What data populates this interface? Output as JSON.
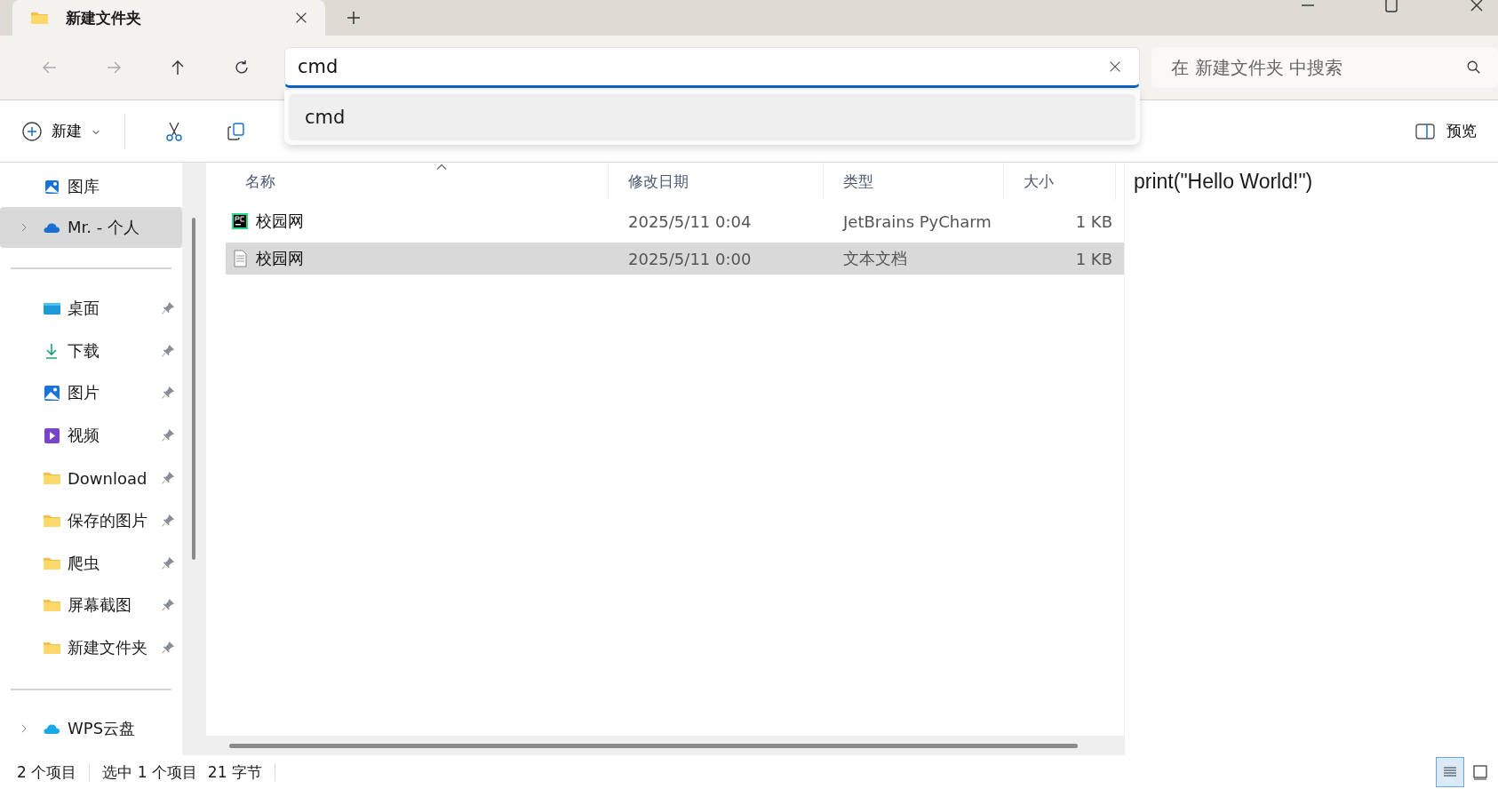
{
  "tab": {
    "title": "新建文件夹",
    "selected": true
  },
  "address": {
    "value": "cmd",
    "suggestions": [
      "cmd"
    ]
  },
  "search": {
    "placeholder": "在 新建文件夹 中搜索"
  },
  "command_bar": {
    "new_label": "新建",
    "preview_label": "预览"
  },
  "sidebar": {
    "top": [
      {
        "label": "图库",
        "kind": "gallery",
        "expandable": false,
        "selected": false
      },
      {
        "label": "Mr. - 个人",
        "kind": "cloud",
        "expandable": true,
        "selected": true
      }
    ],
    "quick_access": [
      {
        "label": "桌面",
        "kind": "desktop",
        "pinned": true,
        "selected": false
      },
      {
        "label": "下载",
        "kind": "downloads",
        "pinned": true,
        "selected": false
      },
      {
        "label": "图片",
        "kind": "pictures",
        "pinned": true,
        "selected": false
      },
      {
        "label": "视频",
        "kind": "videos",
        "pinned": true,
        "selected": false
      },
      {
        "label": "Download",
        "kind": "folder",
        "pinned": true,
        "selected": false
      },
      {
        "label": "保存的图片",
        "kind": "folder",
        "pinned": true,
        "selected": false
      },
      {
        "label": "爬虫",
        "kind": "folder",
        "pinned": true,
        "selected": false
      },
      {
        "label": "屏幕截图",
        "kind": "folder",
        "pinned": true,
        "selected": false
      },
      {
        "label": "新建文件夹",
        "kind": "folder",
        "pinned": true,
        "selected": false
      }
    ],
    "bottom": [
      {
        "label": "WPS云盘",
        "kind": "wps",
        "expandable": true,
        "selected": false
      }
    ]
  },
  "table": {
    "columns": [
      "名称",
      "修改日期",
      "类型",
      "大小"
    ],
    "rows": [
      {
        "name": "校园网",
        "date": "2025/5/11 0:04",
        "type": "JetBrains PyCharm",
        "size": "1 KB",
        "kind": "pycharm",
        "selected": false
      },
      {
        "name": "校园网",
        "date": "2025/5/11 0:00",
        "type": "文本文档",
        "size": "1 KB",
        "kind": "text",
        "selected": true
      }
    ]
  },
  "preview": {
    "text": "print(\"Hello World!\")"
  },
  "status_bar": {
    "item_count": "2 个项目",
    "selection": "选中 1 个项目",
    "size": "21 字节"
  },
  "view_buttons": [
    {
      "kind": "details",
      "selected": true
    },
    {
      "kind": "tiles",
      "selected": false
    }
  ]
}
